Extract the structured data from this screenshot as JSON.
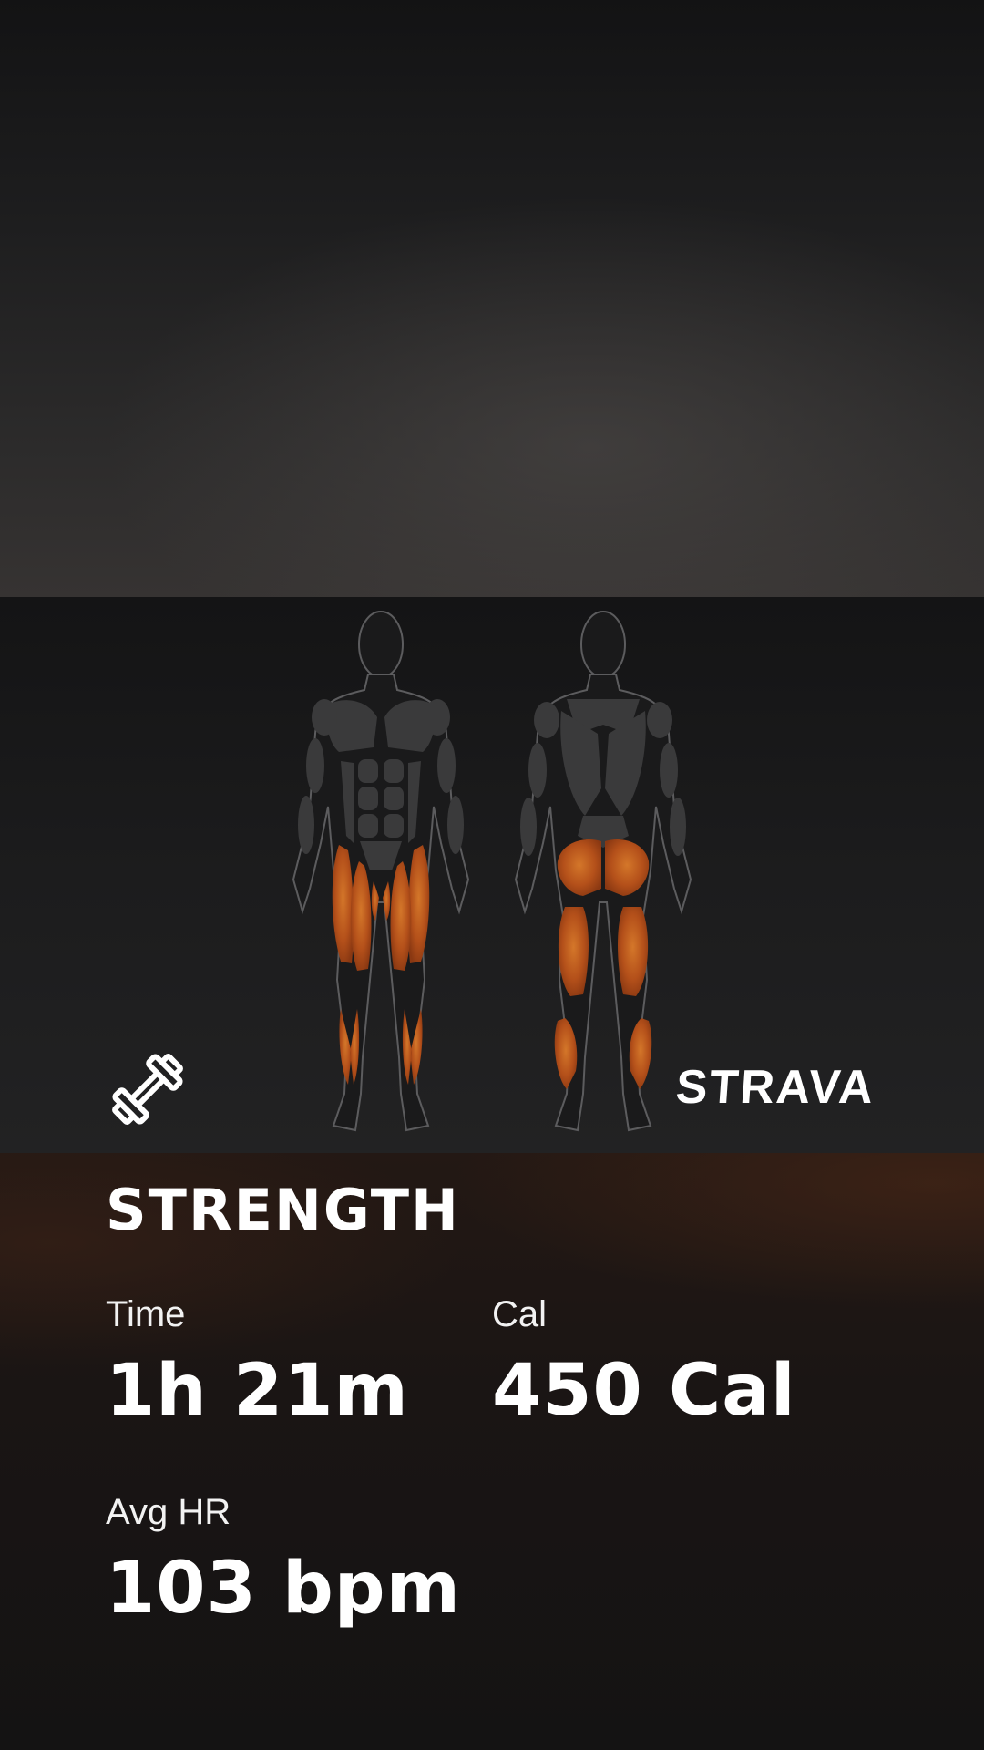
{
  "colors": {
    "background": "#121213",
    "muscle_highlight": "#c4571a",
    "body_fill": "#1b1b1c",
    "muscle_fill": "#3a3a3b"
  },
  "icons": {
    "activity_icon": "dumbbell-icon"
  },
  "brand": {
    "logo_text": "STRAVA"
  },
  "body_map": {
    "highlighted_muscles": [
      "quadriceps",
      "calves",
      "glutes",
      "hamstrings"
    ]
  },
  "activity": {
    "type": "STRENGTH",
    "stats": [
      {
        "label": "Time",
        "value": "1h 21m"
      },
      {
        "label": "Cal",
        "value": "450 Cal"
      },
      {
        "label": "Avg HR",
        "value": "103 bpm"
      }
    ]
  }
}
